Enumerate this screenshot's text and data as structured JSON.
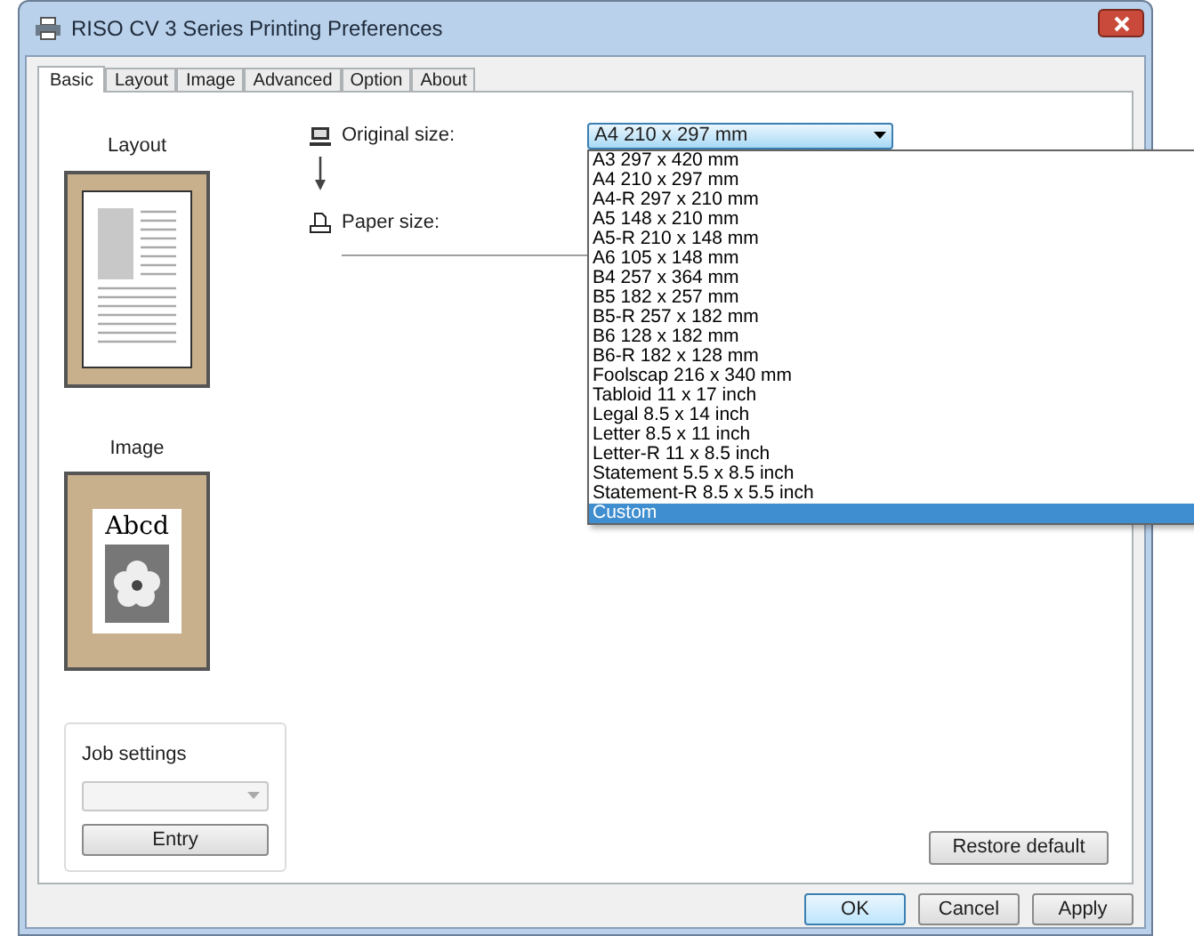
{
  "window": {
    "title": "RISO CV 3 Series Printing Preferences"
  },
  "tabs": [
    {
      "label": "Basic",
      "selected": true
    },
    {
      "label": "Layout",
      "selected": false
    },
    {
      "label": "Image",
      "selected": false
    },
    {
      "label": "Advanced",
      "selected": false
    },
    {
      "label": "Option",
      "selected": false
    },
    {
      "label": "About",
      "selected": false
    }
  ],
  "layout_preview": {
    "label": "Layout"
  },
  "image_preview": {
    "label": "Image",
    "sample_text": "Abcd"
  },
  "job_settings": {
    "title": "Job settings",
    "select_disabled": true,
    "button": "Entry"
  },
  "original_size": {
    "label": "Original size:",
    "value": "A4 210 x 297 mm",
    "expanded": true,
    "options": [
      {
        "label": "A3 297 x 420 mm",
        "highlighted": false
      },
      {
        "label": "A4 210 x 297 mm",
        "highlighted": false
      },
      {
        "label": "A4-R 297 x 210 mm",
        "highlighted": false
      },
      {
        "label": "A5 148 x 210 mm",
        "highlighted": false
      },
      {
        "label": "A5-R 210 x 148 mm",
        "highlighted": false
      },
      {
        "label": "A6 105 x 148 mm",
        "highlighted": false
      },
      {
        "label": "B4 257 x 364 mm",
        "highlighted": false
      },
      {
        "label": "B5 182 x 257 mm",
        "highlighted": false
      },
      {
        "label": "B5-R 257 x 182 mm",
        "highlighted": false
      },
      {
        "label": "B6 128 x 182 mm",
        "highlighted": false
      },
      {
        "label": "B6-R 182 x 128 mm",
        "highlighted": false
      },
      {
        "label": "Foolscap 216 x 340 mm",
        "highlighted": false
      },
      {
        "label": "Tabloid 11 x 17 inch",
        "highlighted": false
      },
      {
        "label": "Legal 8.5 x 14 inch",
        "highlighted": false
      },
      {
        "label": "Letter 8.5 x 11 inch",
        "highlighted": false
      },
      {
        "label": "Letter-R 11 x 8.5 inch",
        "highlighted": false
      },
      {
        "label": "Statement 5.5 x 8.5 inch",
        "highlighted": false
      },
      {
        "label": "Statement-R 8.5 x 5.5 inch",
        "highlighted": false
      },
      {
        "label": "Custom",
        "highlighted": true
      }
    ]
  },
  "paper_size": {
    "label": "Paper size:"
  },
  "restore_button": "Restore default",
  "dialog_buttons": [
    {
      "label": "OK",
      "default": true
    },
    {
      "label": "Cancel",
      "default": false
    },
    {
      "label": "Apply",
      "default": false
    }
  ]
}
